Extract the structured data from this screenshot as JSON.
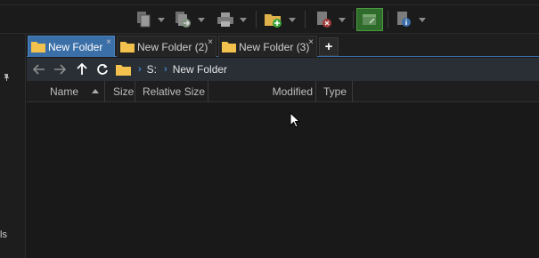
{
  "toolbar": {
    "buttons": [
      {
        "name": "copy-icon"
      },
      {
        "name": "move-icon"
      },
      {
        "name": "print-icon"
      },
      {
        "name": "new-folder-icon"
      },
      {
        "name": "delete-icon"
      },
      {
        "name": "open-terminal-icon"
      },
      {
        "name": "properties-icon"
      }
    ]
  },
  "sidebar": {
    "partial_label": "ls"
  },
  "tabs": [
    {
      "label": "New Folder",
      "active": true
    },
    {
      "label": "New Folder (2)",
      "active": false
    },
    {
      "label": "New Folder (3)",
      "active": false
    }
  ],
  "new_tab_label": "+",
  "close_glyph": "×",
  "nav": {
    "breadcrumbs": [
      "S:",
      "New Folder"
    ],
    "separator": "›"
  },
  "columns": [
    {
      "label": "Name"
    },
    {
      "label": "Size"
    },
    {
      "label": "Relative Size"
    },
    {
      "label": "Modified"
    },
    {
      "label": "Type"
    }
  ],
  "colors": {
    "accent_tab": "#3b6fa8",
    "breadcrumb_separator": "#4aa3ff",
    "folder": "#f2c14e"
  }
}
